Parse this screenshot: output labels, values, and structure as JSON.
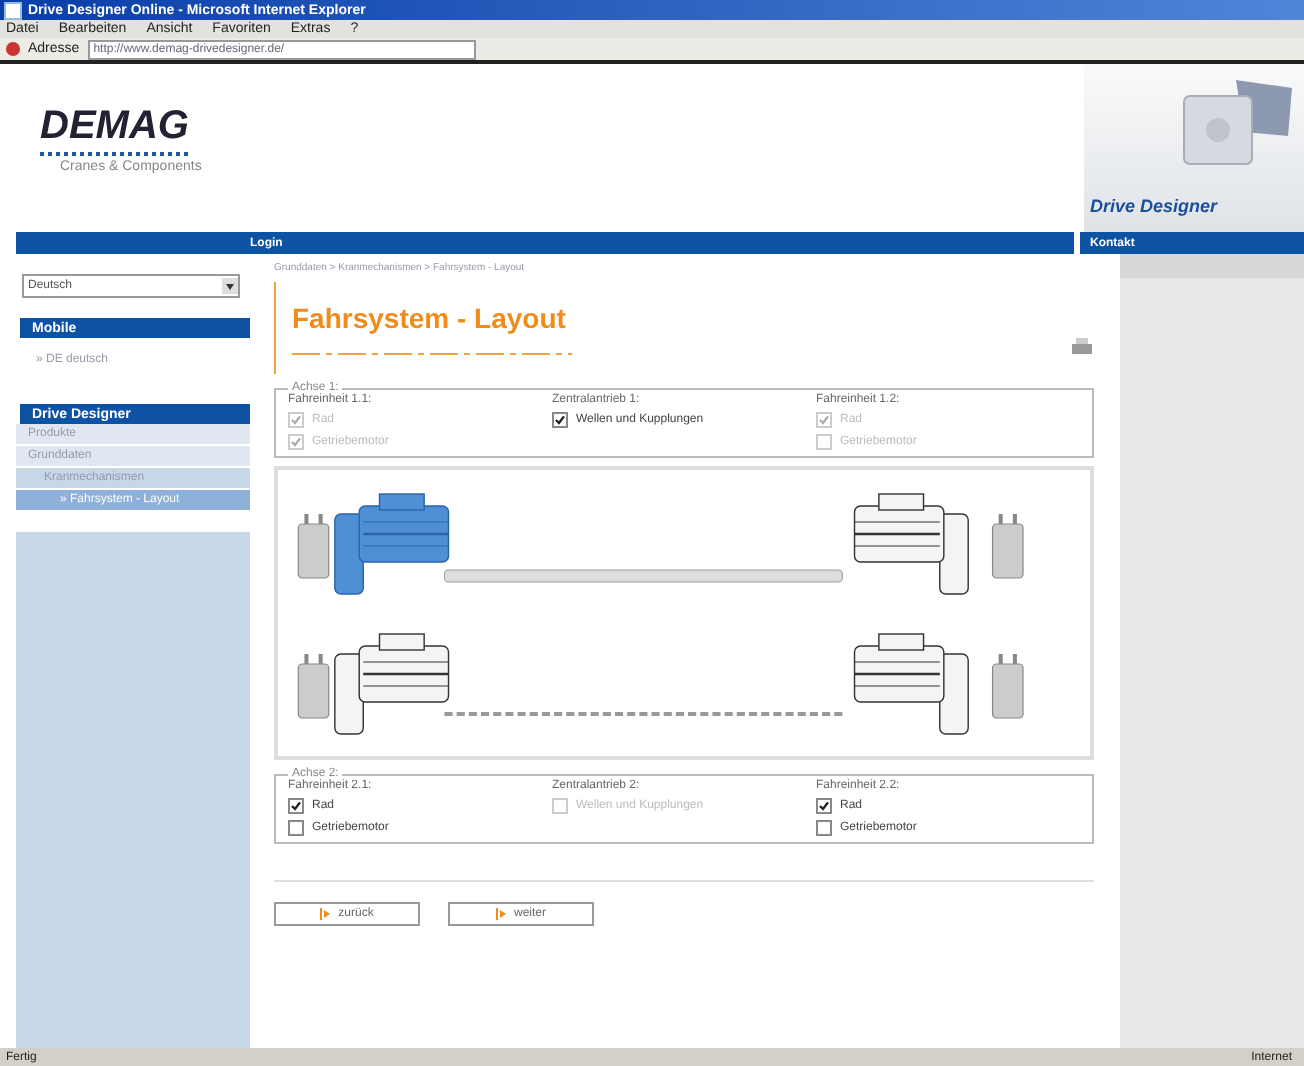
{
  "window": {
    "title": "Drive Designer Online - Microsoft Internet Explorer"
  },
  "menu": [
    "Datei",
    "Bearbeiten",
    "Ansicht",
    "Favoriten",
    "Extras",
    "?"
  ],
  "address_bar": {
    "label": "Adresse",
    "value": "http://www.demag-drivedesigner.de/"
  },
  "logo": {
    "name": "DEMAG",
    "tagline": "Cranes & Components"
  },
  "banner": {
    "title": "Drive Designer"
  },
  "nav": {
    "main": "Login",
    "right": "Kontakt"
  },
  "sidebar": {
    "language": "Deutsch",
    "sections": [
      {
        "title": "Mobile",
        "items": [
          {
            "label": "» DE deutsch",
            "selected": false
          }
        ]
      },
      {
        "title": "Drive Designer",
        "items": [
          {
            "label": "Produkte",
            "selected": false
          },
          {
            "label": "Grunddaten",
            "selected": false,
            "children": [
              {
                "label": "Kranmechanismen",
                "selected": false,
                "children": [
                  {
                    "label": "» Fahrsystem - Layout",
                    "selected": true
                  }
                ]
              }
            ]
          }
        ]
      }
    ]
  },
  "breadcrumb": "Grunddaten > Kranmechanismen > Fahrsystem - Layout",
  "page_title": "Fahrsystem - Layout",
  "axes": [
    {
      "legend": "Achse 1:",
      "groups": [
        {
          "title": "Fahreinheit 1.1:",
          "options": [
            {
              "label": "Rad",
              "checked": true,
              "disabled": true
            },
            {
              "label": "Getriebemotor",
              "checked": true,
              "disabled": true
            }
          ]
        },
        {
          "title": "Zentralantrieb 1:",
          "options": [
            {
              "label": "Wellen und Kupplungen",
              "checked": true,
              "disabled": false
            }
          ]
        },
        {
          "title": "Fahreinheit 1.2:",
          "options": [
            {
              "label": "Rad",
              "checked": true,
              "disabled": true
            },
            {
              "label": "Getriebemotor",
              "checked": false,
              "disabled": true
            }
          ]
        }
      ]
    },
    {
      "legend": "Achse 2:",
      "groups": [
        {
          "title": "Fahreinheit 2.1:",
          "options": [
            {
              "label": "Rad",
              "checked": true,
              "disabled": false
            },
            {
              "label": "Getriebemotor",
              "checked": false,
              "disabled": false
            }
          ]
        },
        {
          "title": "Zentralantrieb 2:",
          "options": [
            {
              "label": "Wellen und Kupplungen",
              "checked": false,
              "disabled": true
            }
          ]
        },
        {
          "title": "Fahreinheit 2.2:",
          "options": [
            {
              "label": "Rad",
              "checked": true,
              "disabled": false
            },
            {
              "label": "Getriebemotor",
              "checked": false,
              "disabled": false
            }
          ]
        }
      ]
    }
  ],
  "buttons": [
    "zurück",
    "weiter"
  ],
  "status_bar": {
    "left": "Fertig",
    "right": "Internet"
  }
}
